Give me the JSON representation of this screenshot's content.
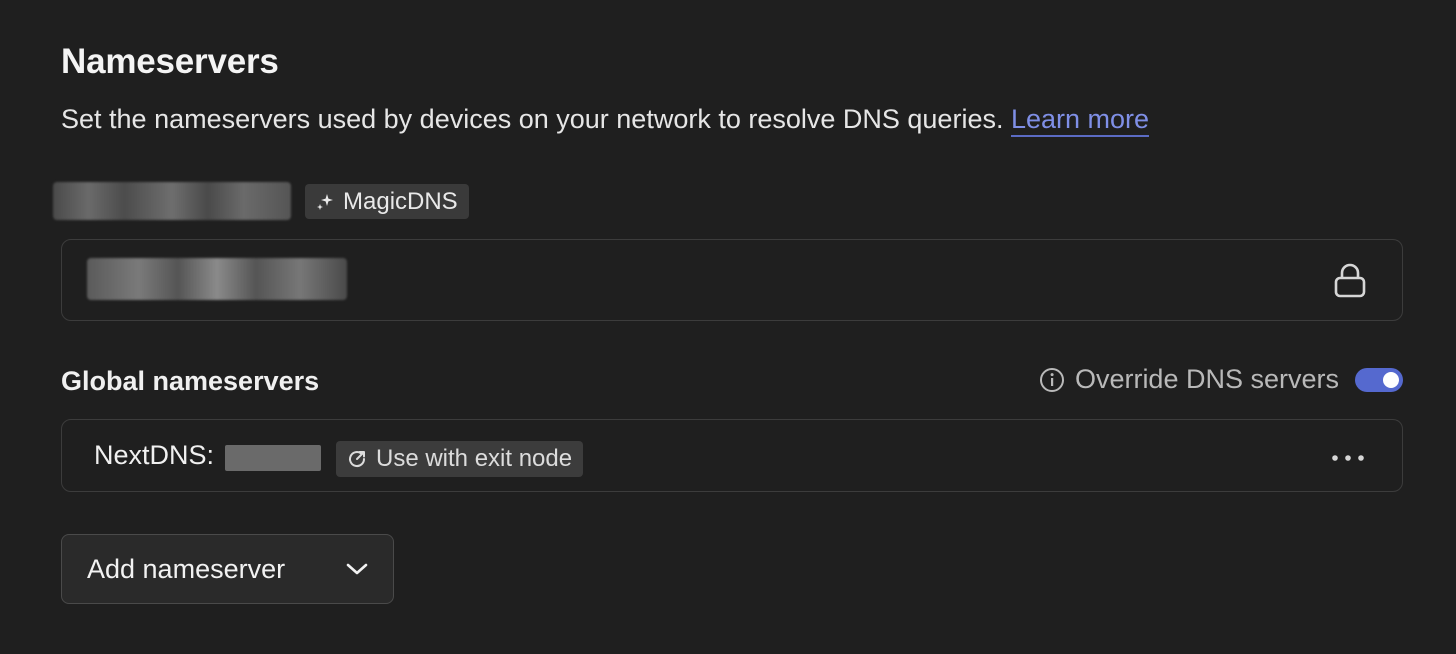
{
  "section": {
    "title": "Nameservers",
    "description": "Set the nameservers used by devices on your network to resolve DNS queries.",
    "learn_more": "Learn more"
  },
  "magicdns": {
    "badge_label": "MagicDNS",
    "badge_icon": "sparkle-icon",
    "field_icon": "lock-icon"
  },
  "global": {
    "label": "Global nameservers",
    "override_label": "Override DNS servers",
    "override_icon": "info-icon",
    "override_enabled": true,
    "toggle_color": "#5569cf"
  },
  "nameserver_row": {
    "label": "NextDNS:",
    "badge_label": "Use with exit node",
    "badge_icon": "exit-node-icon",
    "menu_icon": "more-horizontal-icon"
  },
  "add_button": {
    "label": "Add nameserver",
    "icon": "chevron-down-icon"
  },
  "colors": {
    "background": "#1f1f1f",
    "link": "#7f8fe6",
    "accent": "#5569cf"
  }
}
